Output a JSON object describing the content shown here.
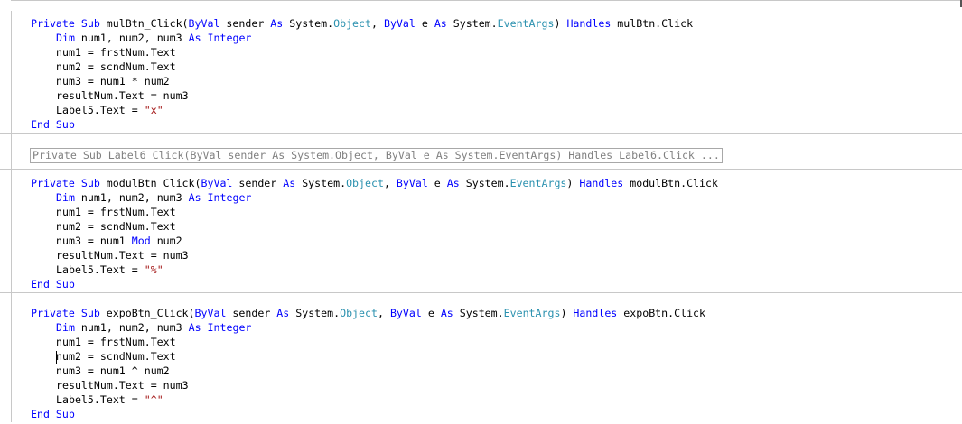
{
  "blocks": [
    {
      "sub": {
        "private": "Private",
        "sub": "Sub",
        "name": "mulBtn_Click(",
        "byval1": "ByVal",
        "p1": " sender ",
        "as1": "As",
        "sys1": " System.",
        "object": "Object",
        "comma": ", ",
        "byval2": "ByVal",
        "p2": " e ",
        "as2": "As",
        "sys2": " System.",
        "eventargs": "EventArgs",
        "close": ") ",
        "handles": "Handles",
        "handler": " mulBtn.Click"
      },
      "dim": {
        "dim": "Dim",
        "vars": " num1, num2, num3 ",
        "as": "As",
        "integer": "Integer"
      },
      "line1": "num1 = frstNum.Text",
      "line2": "num2 = scndNum.Text",
      "line3_pre": "num3 = num1 * num2",
      "line3_kw": "",
      "line3_post": "",
      "line4": "resultNum.Text = num3",
      "line5_pre": "Label5.Text = ",
      "line5_str": "\"x\"",
      "end": "End Sub"
    },
    {
      "sub": {
        "private": "Private",
        "sub": "Sub",
        "name": "modulBtn_Click(",
        "byval1": "ByVal",
        "p1": " sender ",
        "as1": "As",
        "sys1": " System.",
        "object": "Object",
        "comma": ", ",
        "byval2": "ByVal",
        "p2": " e ",
        "as2": "As",
        "sys2": " System.",
        "eventargs": "EventArgs",
        "close": ") ",
        "handles": "Handles",
        "handler": " modulBtn.Click"
      },
      "dim": {
        "dim": "Dim",
        "vars": " num1, num2, num3 ",
        "as": "As",
        "integer": "Integer"
      },
      "line1": "num1 = frstNum.Text",
      "line2": "num2 = scndNum.Text",
      "line3_pre": "num3 = num1 ",
      "line3_kw": "Mod",
      "line3_post": " num2",
      "line4": "resultNum.Text = num3",
      "line5_pre": "Label5.Text = ",
      "line5_str": "\"%\"",
      "end": "End Sub"
    },
    {
      "sub": {
        "private": "Private",
        "sub": "Sub",
        "name": "expoBtn_Click(",
        "byval1": "ByVal",
        "p1": " sender ",
        "as1": "As",
        "sys1": " System.",
        "object": "Object",
        "comma": ", ",
        "byval2": "ByVal",
        "p2": " e ",
        "as2": "As",
        "sys2": " System.",
        "eventargs": "EventArgs",
        "close": ") ",
        "handles": "Handles",
        "handler": " expoBtn.Click"
      },
      "dim": {
        "dim": "Dim",
        "vars": " num1, num2, num3 ",
        "as": "As",
        "integer": "Integer"
      },
      "line1": "num1 = frstNum.Text",
      "line2": "num2 = scndNum.Text",
      "line3_pre": "num3 = num1 ^ num2",
      "line3_kw": "",
      "line3_post": "",
      "line4": "resultNum.Text = num3",
      "line5_pre": "Label5.Text = ",
      "line5_str": "\"^\"",
      "end": "End Sub"
    }
  ],
  "collapsed": "Private Sub Label6_Click(ByVal sender As System.Object, ByVal e As System.EventArgs) Handles Label6.Click ...",
  "colors": {
    "keyword": "#0000ff",
    "type": "#2b91af",
    "string": "#a31515",
    "collapsed_text": "#808080"
  }
}
